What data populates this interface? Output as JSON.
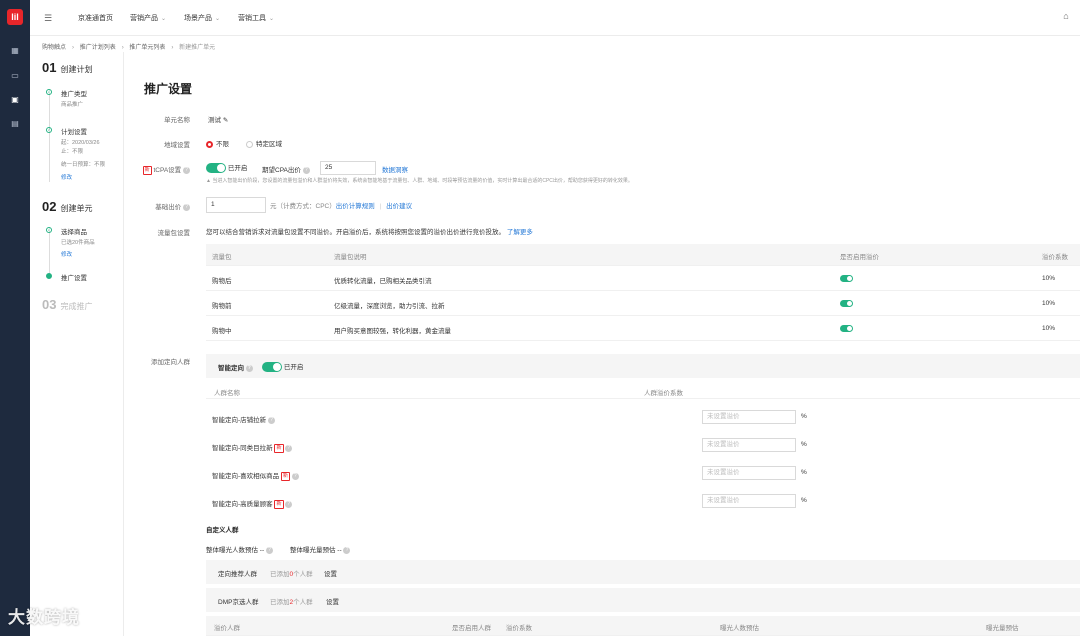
{
  "app": {
    "logo_text": "lil"
  },
  "rail": {
    "icons": [
      "dashboard-icon",
      "message-icon",
      "briefcase-icon",
      "report-icon"
    ]
  },
  "topnav": {
    "items": [
      {
        "label": "京准通首页",
        "has_dropdown": false
      },
      {
        "label": "营销产品",
        "has_dropdown": true
      },
      {
        "label": "场景产品",
        "has_dropdown": true
      },
      {
        "label": "营销工具",
        "has_dropdown": true
      }
    ]
  },
  "breadcrumb": [
    "购物触点",
    "推广计划列表",
    "推广单元列表",
    "新建推广单元"
  ],
  "steps": [
    {
      "num": "01",
      "title": "创建计划"
    },
    {
      "num": "02",
      "title": "创建单元"
    },
    {
      "num": "03",
      "title": "完成推广"
    }
  ],
  "step1_subs": {
    "type_title": "推广类型",
    "type_value": "商品推广",
    "plan_title": "计划设置",
    "plan_line1": "起：2020/03/26",
    "plan_line2": "止：不限",
    "plan_line3": "统一日预算：不限",
    "edit": "修改"
  },
  "step2_subs": {
    "goods_title": "选择商品",
    "goods_value": "已选20件商品",
    "edit": "修改",
    "setting_title": "推广设置"
  },
  "form": {
    "page_title": "推广设置",
    "unit_name_label": "单元名称",
    "unit_name_value": "测试",
    "region_label": "地域设置",
    "region_opt1": "不限",
    "region_opt2": "特定区域",
    "tcpa_badge": "新",
    "tcpa_label": "tCPA设置",
    "tcpa_status": "已开启",
    "expected_cpa_label": "期望CPA出价",
    "expected_cpa_value": "25",
    "data_insight": "数据洞察",
    "tcpa_note": "▲ 当进入智能出价阶段，您设置的流量包溢价和人群溢价将失效，系统会智能地基于流量包、人群、地域、时段等预估流量的价值，实时计算出最合适的CPC出价，帮助您获得更好的转化效果。",
    "base_bid_label": "基础出价",
    "base_bid_value": "1",
    "base_bid_unit": "元（计费方式：CPC）",
    "bid_rule": "出价计算规则",
    "bid_divider": "|",
    "bid_suggest": "出价建议",
    "traffic_label": "流量包设置",
    "traffic_desc": "您可以结合营销诉求对流量包设置不同溢价。开启溢价后，系统将按照您设置的溢价出价进行竞价投放。",
    "learn_more": "了解更多"
  },
  "traffic_table": {
    "headers": [
      "流量包",
      "流量包说明",
      "是否启用溢价",
      "溢价系数"
    ],
    "rows": [
      {
        "name": "购物后",
        "desc": "优质转化流量，已购相关品类引流",
        "enabled": true,
        "rate": "10%"
      },
      {
        "name": "购物前",
        "desc": "亿级流量，深度浏览，助力引流、拉新",
        "enabled": true,
        "rate": "10%"
      },
      {
        "name": "购物中",
        "desc": "用户购买意图较强，转化利器，黄金流量",
        "enabled": true,
        "rate": "10%"
      }
    ]
  },
  "crowd": {
    "label": "添加定向人群",
    "smart_label": "智能定向",
    "smart_status": "已开启",
    "col_name": "人群名称",
    "col_rate": "人群溢价系数",
    "rows": [
      {
        "name": "智能定向-店铺拉新",
        "is_new": false,
        "placeholder": "未设置溢价"
      },
      {
        "name": "智能定向-同类目拉新",
        "is_new": true,
        "placeholder": "未设置溢价"
      },
      {
        "name": "智能定向-喜欢相似商品",
        "is_new": true,
        "placeholder": "未设置溢价"
      },
      {
        "name": "智能定向-高质量顾客",
        "is_new": true,
        "placeholder": "未设置溢价"
      }
    ],
    "new_badge": "新",
    "percent": "%",
    "custom_title": "自定义人群",
    "est_people": "整体曝光人数预估 --",
    "est_exposure": "整体曝光量预估 --",
    "rec_title": "定向推荐人群",
    "rec_added_prefix": "已添加",
    "rec_added_count": "0",
    "rec_added_suffix": "个人群",
    "rec_setting": "设置",
    "dmp_title": "DMP京选人群",
    "dmp_added_prefix": "已添加",
    "dmp_added_count": "2",
    "dmp_added_suffix": "个人群",
    "dmp_setting": "设置",
    "bottom_headers": [
      "溢价人群",
      "是否启用人群",
      "溢价系数",
      "曝光人数预估",
      "曝光量预估"
    ]
  },
  "watermark": "大数跨境",
  "colors": {
    "brand_red": "#e8262a",
    "success_green": "#23b283",
    "link_blue": "#2277d6",
    "rail_bg": "#1e2a3e"
  }
}
